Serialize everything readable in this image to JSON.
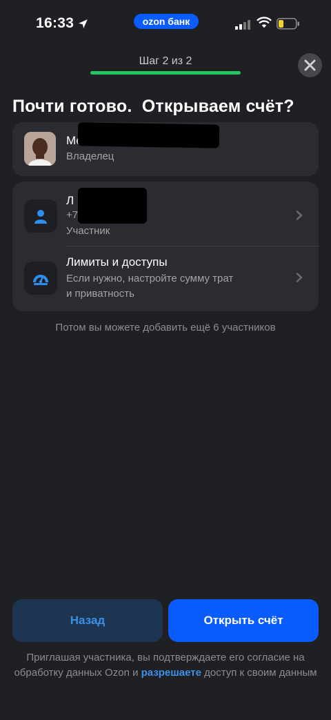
{
  "status_bar": {
    "time": "16:33",
    "app_pill": "ozon банк"
  },
  "header": {
    "step": "Шаг 2 из 2",
    "progress": 1.0,
    "close_icon": "close-icon"
  },
  "title": "Почти готово.  Открываем счёт?",
  "owner": {
    "name_visible": "Ме",
    "role": "Владелец"
  },
  "member": {
    "name_visible": "Л",
    "phone_visible": "+7",
    "role": "Участник",
    "icon": "user-icon"
  },
  "limits": {
    "title": "Лимиты и доступы",
    "description_line1": "Если нужно, настройте сумму трат",
    "description_line2": "и приватность",
    "icon": "speedometer-icon"
  },
  "hint": "Потом вы можете добавить ещё 6 участников",
  "buttons": {
    "back": "Назад",
    "open": "Открыть счёт"
  },
  "footer": {
    "text_before": "Приглашая участника, вы подтверждаете его согласие на обработку данных Ozon и ",
    "link": "разрешаете",
    "text_after": " доступ к своим данным"
  },
  "colors": {
    "accent": "#0a5cff",
    "progress": "#22c55e",
    "link": "#3d8fe8"
  }
}
